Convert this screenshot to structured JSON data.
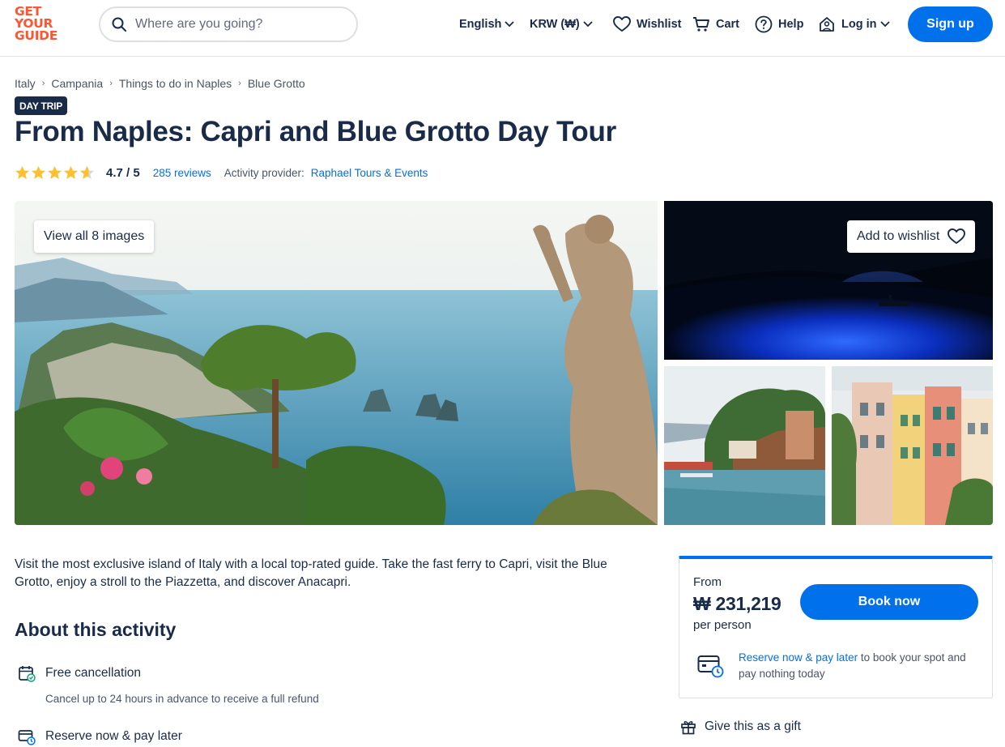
{
  "header": {
    "logo_lines": [
      "GET",
      "YOUR",
      "GUIDE"
    ],
    "search_placeholder": "Where are you going?",
    "language": "English",
    "currency": "KRW (₩)",
    "wishlist": "Wishlist",
    "cart": "Cart",
    "help": "Help",
    "login": "Log in",
    "signup": "Sign up"
  },
  "breadcrumb": [
    "Italy",
    "Campania",
    "Things to do in Naples",
    "Blue Grotto"
  ],
  "badge": "DAY TRIP",
  "title": "From Naples: Capri and Blue Grotto Day Tour",
  "rating": {
    "value": "4.7",
    "out_of": "/ 5",
    "stars": 4.7,
    "reviews": "285 reviews",
    "provider_label": "Activity provider:",
    "provider": "Raphael Tours & Events"
  },
  "gallery": {
    "view_all": "View all 8 images",
    "add_to_wishlist": "Add to wishlist"
  },
  "description": "Visit the most exclusive island of Italy with a local top-rated guide. Take the fast ferry to Capri, visit the Blue Grotto, enjoy a stroll to the Piazzetta, and discover Anacapri.",
  "about": {
    "heading": "About this activity",
    "features": [
      {
        "icon": "calendar-check-icon",
        "title": "Free cancellation",
        "subtitle": "Cancel up to 24 hours in advance to receive a full refund"
      },
      {
        "icon": "card-clock-icon",
        "title": "Reserve now & pay later"
      }
    ]
  },
  "booking": {
    "from": "From",
    "price": "₩ 231,219",
    "per": "per person",
    "book_now": "Book now",
    "reserve_link": "Reserve now & pay later",
    "reserve_rest": " to book your spot and pay nothing today"
  },
  "gift": "Give this as a gift",
  "colors": {
    "brand": "#ff5533",
    "accent": "#0071eb",
    "text": "#1a2b49",
    "star": "#ffc02e"
  }
}
